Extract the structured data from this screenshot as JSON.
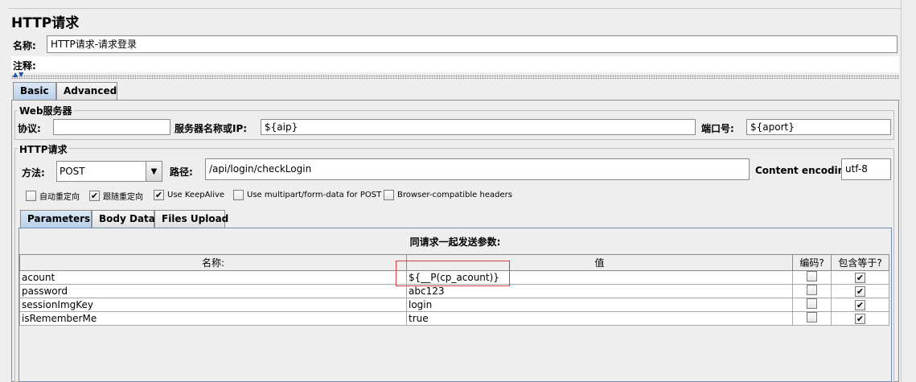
{
  "panel": {
    "title": "HTTP请求",
    "name_label": "名称:",
    "name_value": "HTTP请求-请求登录",
    "comment_label": "注释:",
    "comment_value": ""
  },
  "config_tabs": [
    {
      "label": "Basic",
      "active": true
    },
    {
      "label": "Advanced",
      "active": false
    }
  ],
  "web_server": {
    "group_title": "Web服务器",
    "protocol_label": "协议:",
    "protocol_value": "",
    "server_label": "服务器名称或IP:",
    "server_value": "${aip}",
    "port_label": "端口号:",
    "port_value": "${aport}"
  },
  "http_request": {
    "group_title": "HTTP请求",
    "method_label": "方法:",
    "method_value": "POST",
    "path_label": "路径:",
    "path_value": "/api/login/checkLogin",
    "encoding_label": "Content encoding:",
    "encoding_value": "utf-8"
  },
  "options": [
    {
      "label": "自动重定向",
      "checked": false
    },
    {
      "label": "跟随重定向",
      "checked": true
    },
    {
      "label": "Use KeepAlive",
      "checked": true
    },
    {
      "label": "Use multipart/form-data for POST",
      "checked": false
    },
    {
      "label": "Browser-compatible headers",
      "checked": false
    }
  ],
  "param_tabs": [
    {
      "label": "Parameters",
      "active": true
    },
    {
      "label": "Body Data",
      "active": false
    },
    {
      "label": "Files Upload",
      "active": false
    }
  ],
  "params_table": {
    "caption": "同请求一起发送参数:",
    "columns": [
      "名称:",
      "值",
      "编码?",
      "包含等于?"
    ],
    "rows": [
      {
        "name": "acount",
        "value": "${__P(cp_acount)}",
        "encode": false,
        "include_equals": true
      },
      {
        "name": "password",
        "value": "abc123",
        "encode": false,
        "include_equals": true
      },
      {
        "name": "sessionImgKey",
        "value": "login",
        "encode": false,
        "include_equals": true
      },
      {
        "name": "isRememberMe",
        "value": "true",
        "encode": false,
        "include_equals": true
      }
    ]
  },
  "icons": {
    "collapse": "collapse-arrows-icon",
    "dropdown": "chevron-down-icon",
    "check": "checkmark-icon"
  },
  "colors": {
    "active_tab": "#b9d0ea",
    "highlight_box": "#d23b3b",
    "background": "#eeeeee"
  }
}
